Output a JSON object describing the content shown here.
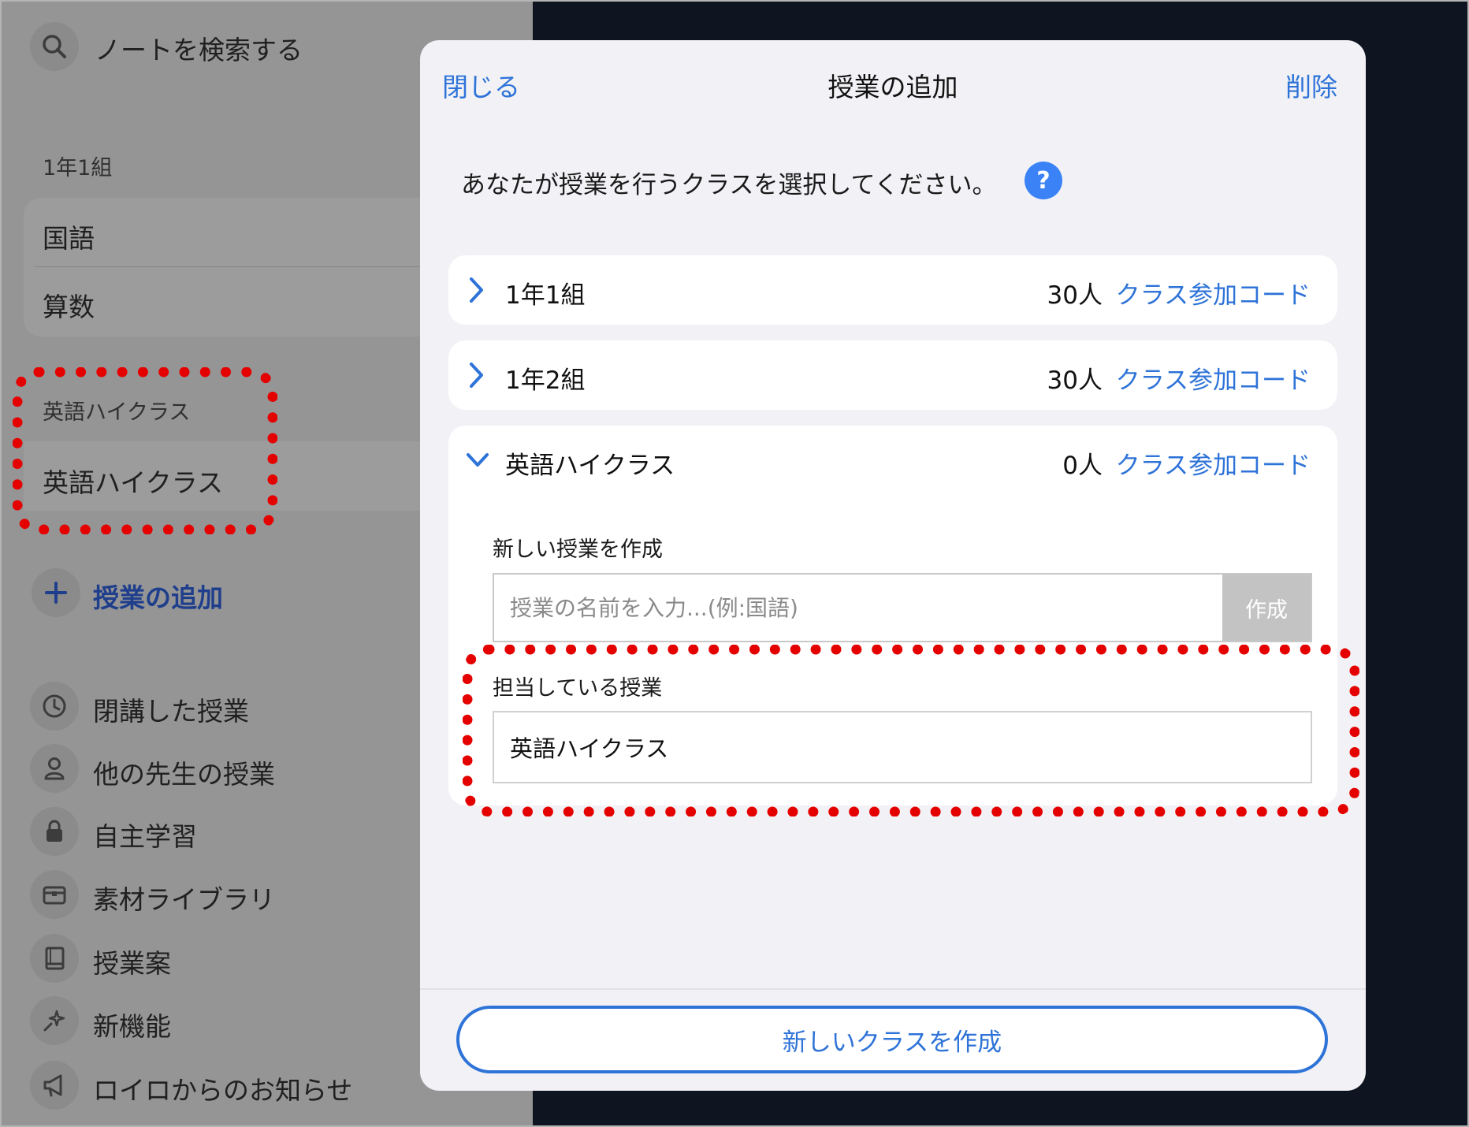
{
  "sidebar": {
    "search_label": "ノートを検索する",
    "section1_header": "1年1組",
    "section1_items": [
      "国語",
      "算数"
    ],
    "section2_header": "英語ハイクラス",
    "section2_item": "英語ハイクラス",
    "add_lesson_label": "授業の追加",
    "menu": [
      {
        "label": "閉講した授業",
        "icon": "clock-icon"
      },
      {
        "label": "他の先生の授業",
        "icon": "person-icon"
      },
      {
        "label": "自主学習",
        "icon": "lock-icon"
      },
      {
        "label": "素材ライブラリ",
        "icon": "chest-icon"
      },
      {
        "label": "授業案",
        "icon": "book-icon"
      },
      {
        "label": "新機能",
        "icon": "sparkle-icon"
      },
      {
        "label": "ロイロからのお知らせ",
        "icon": "megaphone-icon"
      }
    ]
  },
  "modal": {
    "close_label": "閉じる",
    "title": "授業の追加",
    "delete_label": "削除",
    "instruction": "あなたが授業を行うクラスを選択してください。",
    "help_symbol": "?",
    "classes": [
      {
        "name": "1年1組",
        "count": "30人",
        "code_label": "クラス参加コード",
        "expanded": false
      },
      {
        "name": "1年2組",
        "count": "30人",
        "code_label": "クラス参加コード",
        "expanded": false
      },
      {
        "name": "英語ハイクラス",
        "count": "0人",
        "code_label": "クラス参加コード",
        "expanded": true
      }
    ],
    "new_lesson_label": "新しい授業を作成",
    "new_lesson_placeholder": "授業の名前を入力...(例:国語)",
    "create_label": "作成",
    "assigned_label": "担当している授業",
    "assigned_lesson": "英語ハイクラス",
    "new_class_label": "新しいクラスを作成"
  },
  "colors": {
    "accent": "#2e73d8",
    "highlight": "#e50000",
    "help_button": "#3b82f6",
    "sidebar_dim": "#959595",
    "backdrop": "#0e1420"
  }
}
